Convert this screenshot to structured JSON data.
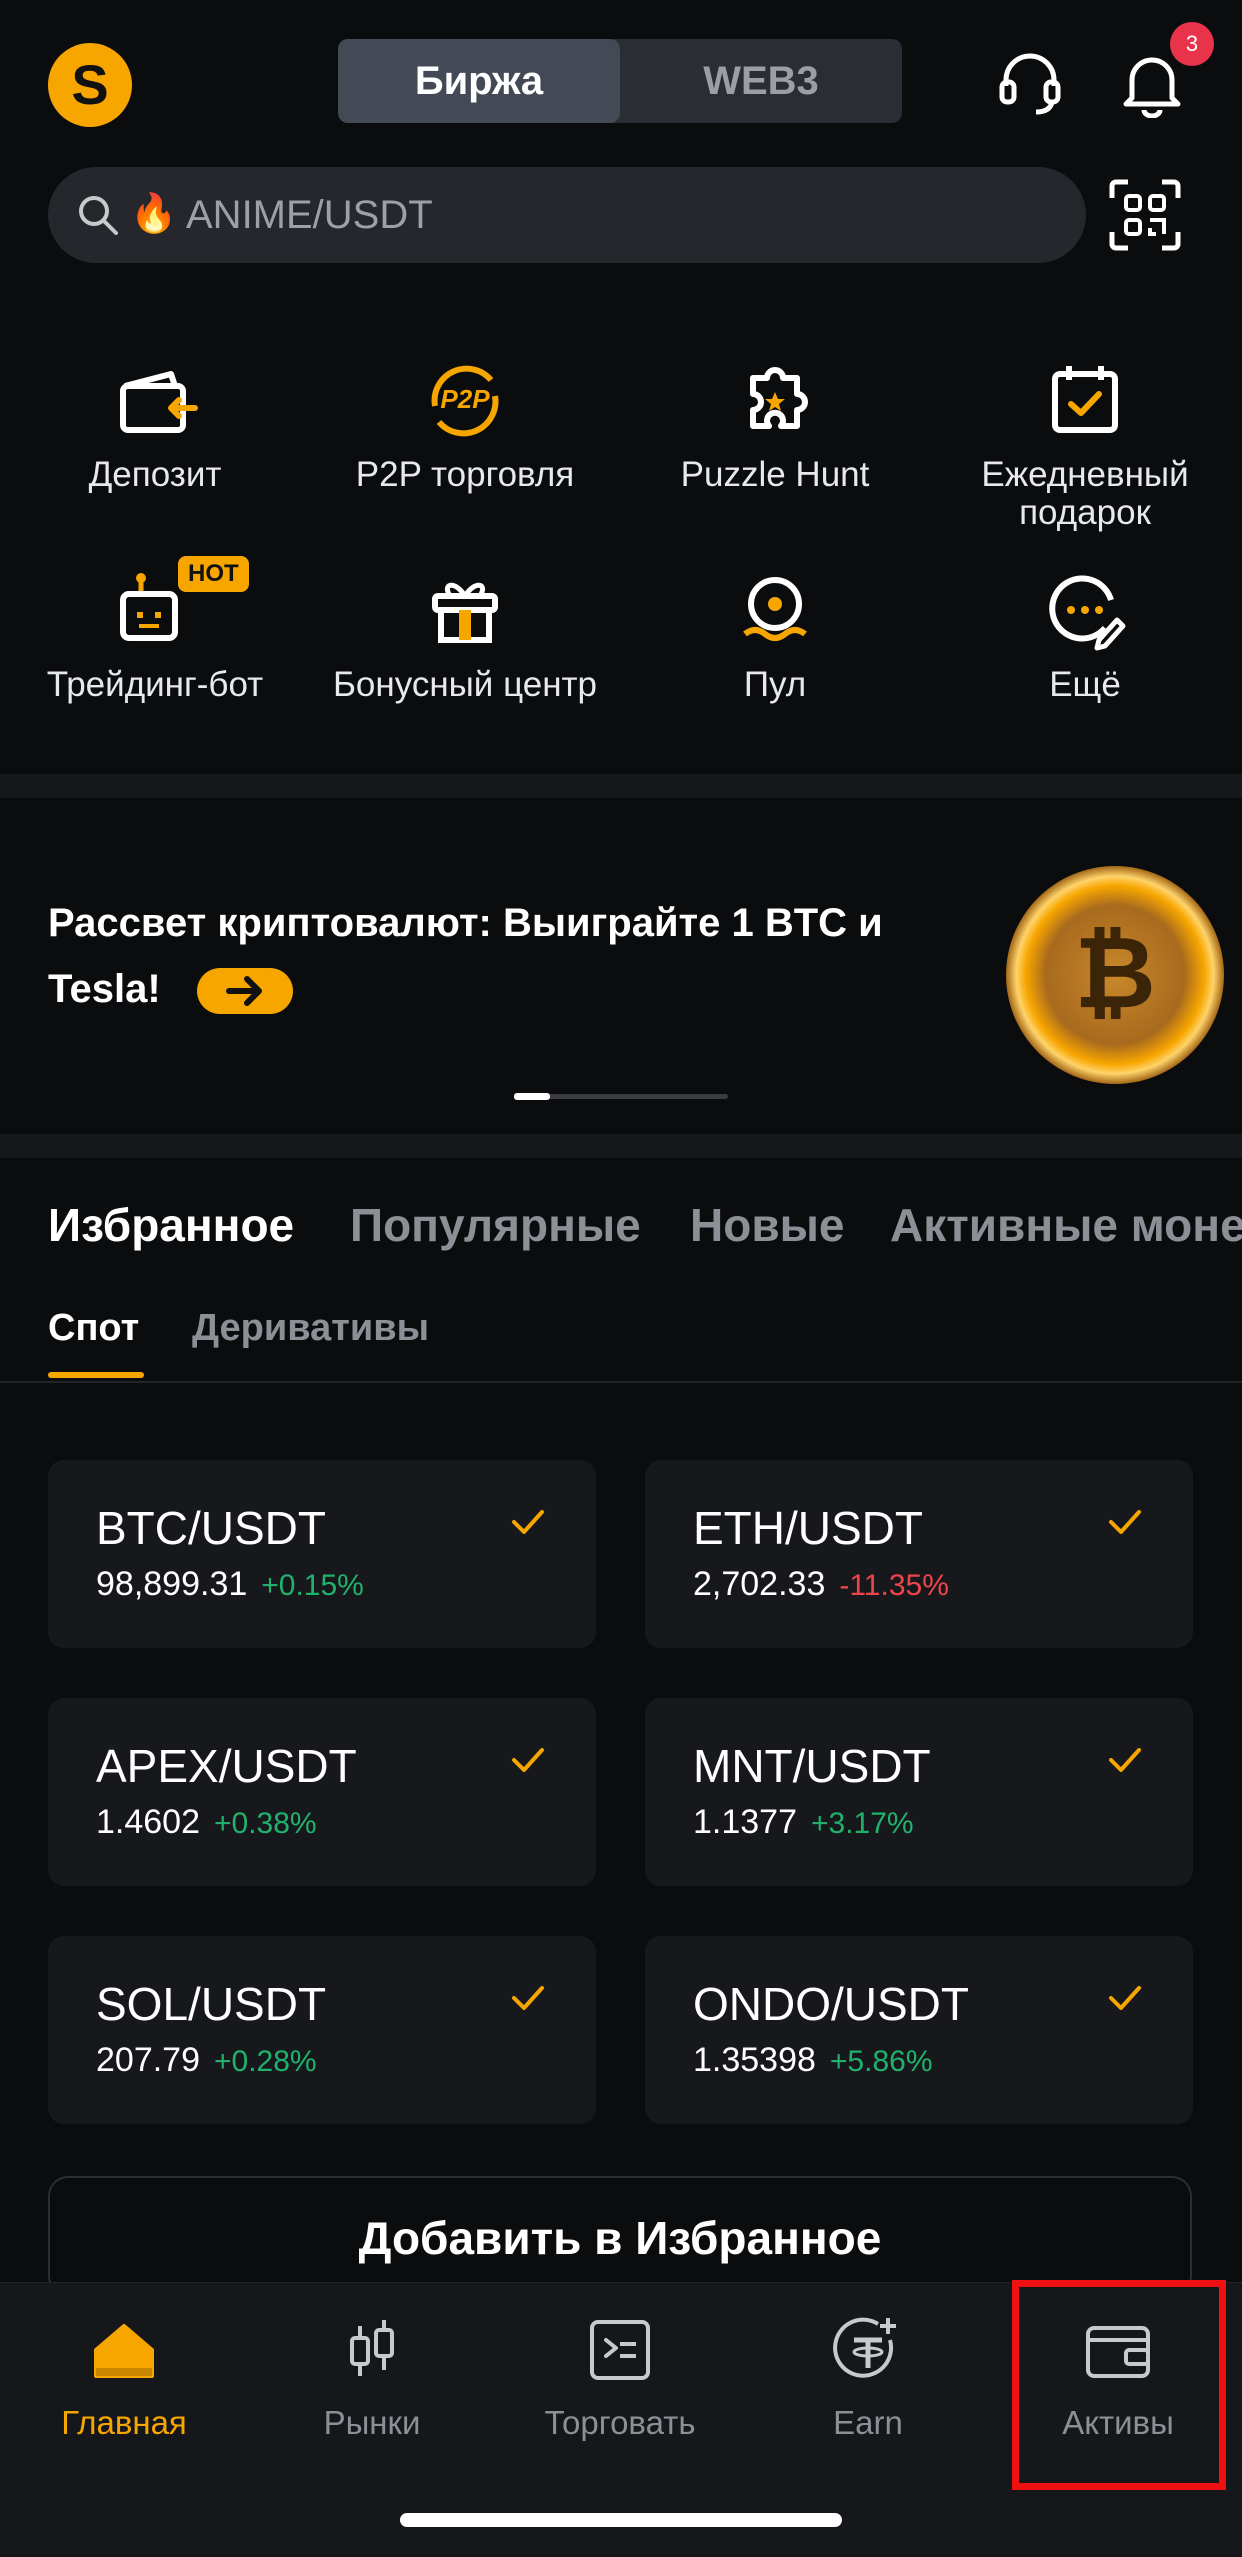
{
  "header": {
    "avatar_letter": "S",
    "segment": [
      "Биржа",
      "WEB3"
    ],
    "notification_count": "3"
  },
  "search": {
    "emoji": "🔥",
    "placeholder": "ANIME/USDT"
  },
  "quick_menu": [
    {
      "label": "Депозит",
      "icon": "deposit-icon"
    },
    {
      "label": "P2P торговля",
      "icon": "p2p-icon"
    },
    {
      "label": "Puzzle Hunt",
      "icon": "puzzle-icon"
    },
    {
      "label": "Ежедневный подарок",
      "icon": "calendar-check-icon"
    },
    {
      "label": "Трейдинг-бот",
      "icon": "trading-bot-icon",
      "badge": "HOT"
    },
    {
      "label": "Бонусный центр",
      "icon": "gift-icon"
    },
    {
      "label": "Пул",
      "icon": "pool-icon"
    },
    {
      "label": "Ещё",
      "icon": "more-icon"
    }
  ],
  "banner": {
    "title": "Рассвет криптовалют: Выиграйте 1 BTC и Tesla!",
    "coin_symbol": "₿"
  },
  "tabs": [
    "Избранное",
    "Популярные",
    "Новые",
    "Активные моне"
  ],
  "subtabs": [
    "Спот",
    "Деривативы"
  ],
  "favorites": [
    {
      "pair": "BTC/USDT",
      "price": "98,899.31",
      "change": "+0.15%",
      "direction": "up"
    },
    {
      "pair": "ETH/USDT",
      "price": "2,702.33",
      "change": "-11.35%",
      "direction": "down"
    },
    {
      "pair": "APEX/USDT",
      "price": "1.4602",
      "change": "+0.38%",
      "direction": "up"
    },
    {
      "pair": "MNT/USDT",
      "price": "1.1377",
      "change": "+3.17%",
      "direction": "up"
    },
    {
      "pair": "SOL/USDT",
      "price": "207.79",
      "change": "+0.28%",
      "direction": "up"
    },
    {
      "pair": "ONDO/USDT",
      "price": "1.35398",
      "change": "+5.86%",
      "direction": "up"
    }
  ],
  "add_favorites_label": "Добавить в Избранное",
  "bottom_nav": [
    {
      "label": "Главная",
      "icon": "home-icon",
      "active": true
    },
    {
      "label": "Рынки",
      "icon": "candles-icon"
    },
    {
      "label": "Торговать",
      "icon": "terminal-icon"
    },
    {
      "label": "Earn",
      "icon": "tether-plus-icon"
    },
    {
      "label": "Активы",
      "icon": "wallet-icon",
      "highlighted": true
    }
  ],
  "colors": {
    "accent": "#f7a600",
    "up": "#20b26c",
    "down": "#ef454a",
    "background": "#0b0c0e",
    "highlight": "#ef1111"
  }
}
